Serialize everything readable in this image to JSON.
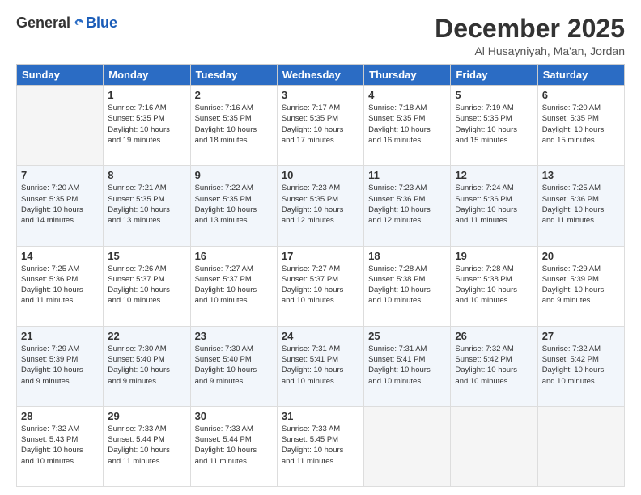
{
  "logo": {
    "general": "General",
    "blue": "Blue"
  },
  "title": "December 2025",
  "location": "Al Husayniyah, Ma'an, Jordan",
  "days_of_week": [
    "Sunday",
    "Monday",
    "Tuesday",
    "Wednesday",
    "Thursday",
    "Friday",
    "Saturday"
  ],
  "weeks": [
    [
      {
        "day": "",
        "info": ""
      },
      {
        "day": "1",
        "info": "Sunrise: 7:16 AM\nSunset: 5:35 PM\nDaylight: 10 hours\nand 19 minutes."
      },
      {
        "day": "2",
        "info": "Sunrise: 7:16 AM\nSunset: 5:35 PM\nDaylight: 10 hours\nand 18 minutes."
      },
      {
        "day": "3",
        "info": "Sunrise: 7:17 AM\nSunset: 5:35 PM\nDaylight: 10 hours\nand 17 minutes."
      },
      {
        "day": "4",
        "info": "Sunrise: 7:18 AM\nSunset: 5:35 PM\nDaylight: 10 hours\nand 16 minutes."
      },
      {
        "day": "5",
        "info": "Sunrise: 7:19 AM\nSunset: 5:35 PM\nDaylight: 10 hours\nand 15 minutes."
      },
      {
        "day": "6",
        "info": "Sunrise: 7:20 AM\nSunset: 5:35 PM\nDaylight: 10 hours\nand 15 minutes."
      }
    ],
    [
      {
        "day": "7",
        "info": "Sunrise: 7:20 AM\nSunset: 5:35 PM\nDaylight: 10 hours\nand 14 minutes."
      },
      {
        "day": "8",
        "info": "Sunrise: 7:21 AM\nSunset: 5:35 PM\nDaylight: 10 hours\nand 13 minutes."
      },
      {
        "day": "9",
        "info": "Sunrise: 7:22 AM\nSunset: 5:35 PM\nDaylight: 10 hours\nand 13 minutes."
      },
      {
        "day": "10",
        "info": "Sunrise: 7:23 AM\nSunset: 5:35 PM\nDaylight: 10 hours\nand 12 minutes."
      },
      {
        "day": "11",
        "info": "Sunrise: 7:23 AM\nSunset: 5:36 PM\nDaylight: 10 hours\nand 12 minutes."
      },
      {
        "day": "12",
        "info": "Sunrise: 7:24 AM\nSunset: 5:36 PM\nDaylight: 10 hours\nand 11 minutes."
      },
      {
        "day": "13",
        "info": "Sunrise: 7:25 AM\nSunset: 5:36 PM\nDaylight: 10 hours\nand 11 minutes."
      }
    ],
    [
      {
        "day": "14",
        "info": "Sunrise: 7:25 AM\nSunset: 5:36 PM\nDaylight: 10 hours\nand 11 minutes."
      },
      {
        "day": "15",
        "info": "Sunrise: 7:26 AM\nSunset: 5:37 PM\nDaylight: 10 hours\nand 10 minutes."
      },
      {
        "day": "16",
        "info": "Sunrise: 7:27 AM\nSunset: 5:37 PM\nDaylight: 10 hours\nand 10 minutes."
      },
      {
        "day": "17",
        "info": "Sunrise: 7:27 AM\nSunset: 5:37 PM\nDaylight: 10 hours\nand 10 minutes."
      },
      {
        "day": "18",
        "info": "Sunrise: 7:28 AM\nSunset: 5:38 PM\nDaylight: 10 hours\nand 10 minutes."
      },
      {
        "day": "19",
        "info": "Sunrise: 7:28 AM\nSunset: 5:38 PM\nDaylight: 10 hours\nand 10 minutes."
      },
      {
        "day": "20",
        "info": "Sunrise: 7:29 AM\nSunset: 5:39 PM\nDaylight: 10 hours\nand 9 minutes."
      }
    ],
    [
      {
        "day": "21",
        "info": "Sunrise: 7:29 AM\nSunset: 5:39 PM\nDaylight: 10 hours\nand 9 minutes."
      },
      {
        "day": "22",
        "info": "Sunrise: 7:30 AM\nSunset: 5:40 PM\nDaylight: 10 hours\nand 9 minutes."
      },
      {
        "day": "23",
        "info": "Sunrise: 7:30 AM\nSunset: 5:40 PM\nDaylight: 10 hours\nand 9 minutes."
      },
      {
        "day": "24",
        "info": "Sunrise: 7:31 AM\nSunset: 5:41 PM\nDaylight: 10 hours\nand 10 minutes."
      },
      {
        "day": "25",
        "info": "Sunrise: 7:31 AM\nSunset: 5:41 PM\nDaylight: 10 hours\nand 10 minutes."
      },
      {
        "day": "26",
        "info": "Sunrise: 7:32 AM\nSunset: 5:42 PM\nDaylight: 10 hours\nand 10 minutes."
      },
      {
        "day": "27",
        "info": "Sunrise: 7:32 AM\nSunset: 5:42 PM\nDaylight: 10 hours\nand 10 minutes."
      }
    ],
    [
      {
        "day": "28",
        "info": "Sunrise: 7:32 AM\nSunset: 5:43 PM\nDaylight: 10 hours\nand 10 minutes."
      },
      {
        "day": "29",
        "info": "Sunrise: 7:33 AM\nSunset: 5:44 PM\nDaylight: 10 hours\nand 11 minutes."
      },
      {
        "day": "30",
        "info": "Sunrise: 7:33 AM\nSunset: 5:44 PM\nDaylight: 10 hours\nand 11 minutes."
      },
      {
        "day": "31",
        "info": "Sunrise: 7:33 AM\nSunset: 5:45 PM\nDaylight: 10 hours\nand 11 minutes."
      },
      {
        "day": "",
        "info": ""
      },
      {
        "day": "",
        "info": ""
      },
      {
        "day": "",
        "info": ""
      }
    ]
  ]
}
